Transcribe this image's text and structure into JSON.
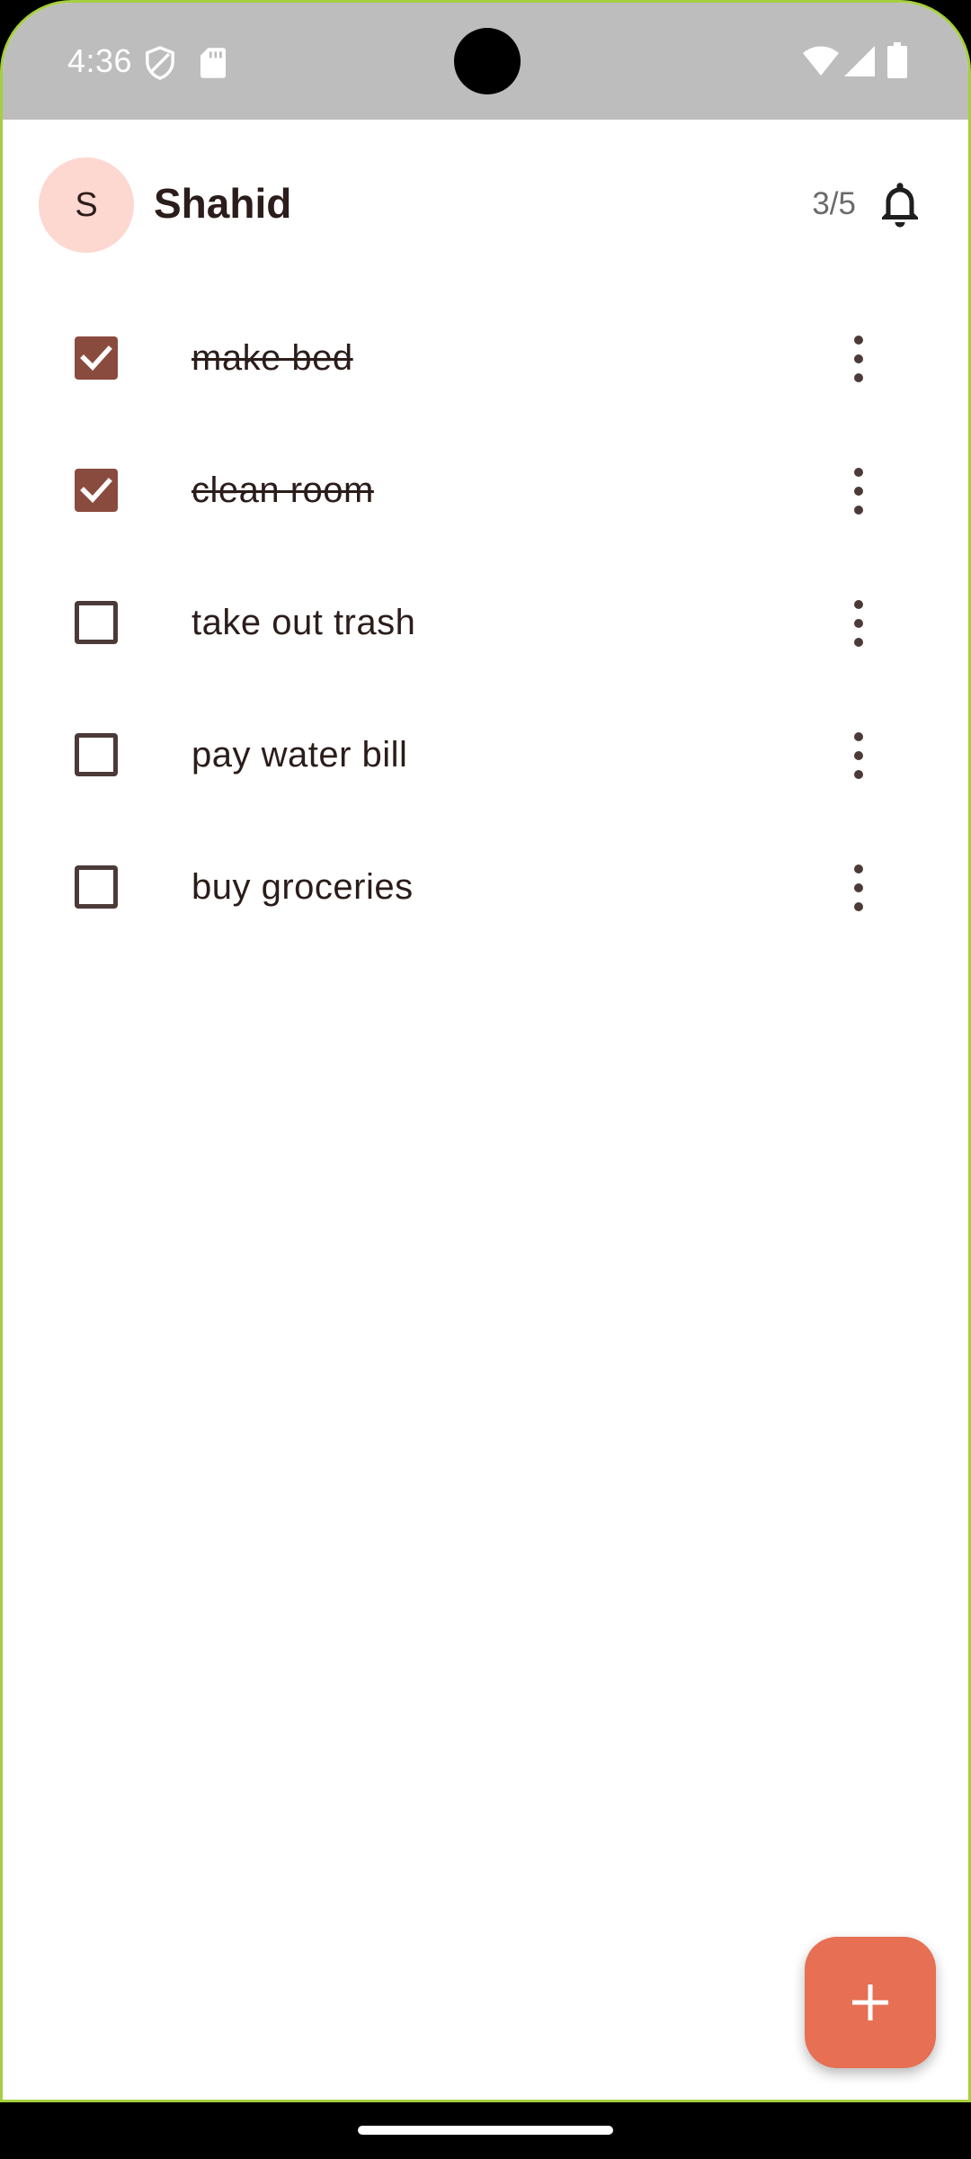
{
  "status_bar": {
    "time": "4:36",
    "icons": [
      "shield-icon",
      "sd-card-icon",
      "wifi-icon",
      "cellular-signal-icon",
      "battery-icon"
    ]
  },
  "header": {
    "avatar_initial": "S",
    "user_name": "Shahid",
    "progress": "3/5",
    "bell_icon": "notification-bell-icon"
  },
  "tasks": [
    {
      "label": "make bed",
      "done": true
    },
    {
      "label": "clean room",
      "done": true
    },
    {
      "label": "take out trash",
      "done": false
    },
    {
      "label": "pay water bill",
      "done": false
    },
    {
      "label": "buy groceries",
      "done": false
    }
  ],
  "fab": {
    "icon": "plus-icon"
  },
  "colors": {
    "status_bar": "#bdbdbd",
    "avatar_bg": "#fdd8d1",
    "checkbox_checked": "#8a4b3f",
    "fab": "#e66f54",
    "text": "#2b1d1b"
  }
}
